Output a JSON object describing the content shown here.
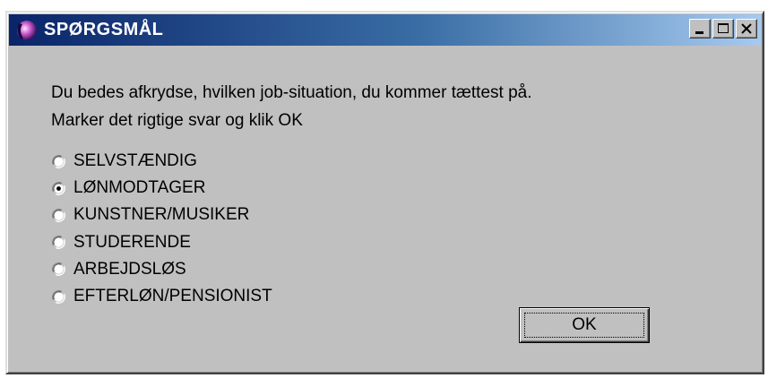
{
  "window": {
    "title": "SPØRGSMÅL",
    "controls": {
      "minimize": "minimize-icon",
      "maximize": "maximize-icon",
      "close": "close-icon"
    }
  },
  "instructions": {
    "line1": "Du bedes afkrydse, hvilken job-situation, du kommer tættest på.",
    "line2": "Marker det rigtige svar og klik OK"
  },
  "options": [
    {
      "label": "SELVSTÆNDIG",
      "selected": false
    },
    {
      "label": "LØNMODTAGER",
      "selected": true
    },
    {
      "label": "KUNSTNER/MUSIKER",
      "selected": false
    },
    {
      "label": "STUDERENDE",
      "selected": false
    },
    {
      "label": "ARBEJDSLØS",
      "selected": false
    },
    {
      "label": "EFTERLØN/PENSIONIST",
      "selected": false
    }
  ],
  "ok_button": {
    "label": "OK"
  },
  "colors": {
    "titlebar_start": "#0a246a",
    "titlebar_end": "#a6caf0",
    "face": "#c0c0c0"
  }
}
